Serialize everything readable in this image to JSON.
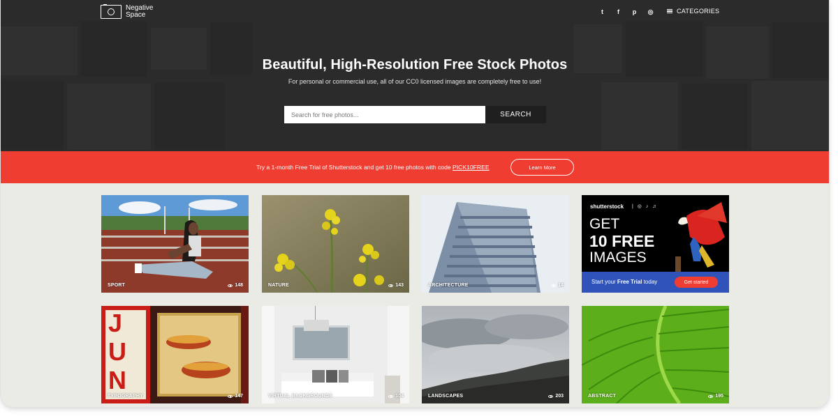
{
  "brand": {
    "line1": "Negative",
    "line2": "Space"
  },
  "nav": {
    "social": [
      "twitter",
      "facebook",
      "pinterest",
      "instagram"
    ],
    "social_glyphs": [
      "t",
      "f",
      "p",
      "◎"
    ],
    "categories_label": "CATEGORIES"
  },
  "hero": {
    "title": "Beautiful, High-Resolution Free Stock Photos",
    "subtitle": "For personal or commercial use, all of our CC0 licensed images are completely free to use!",
    "search_placeholder": "Search for free photos...",
    "search_button": "SEARCH"
  },
  "promo": {
    "text": "Try a 1-month Free Trial of Shutterstock and get 10 free photos with code ",
    "code": "PICK10FREE",
    "button": "Learn More",
    "color": "#ef3d32"
  },
  "cards": [
    {
      "category": "SPORT",
      "views": "148"
    },
    {
      "category": "NATURE",
      "views": "143"
    },
    {
      "category": "ARCHITECTURE",
      "views": "14"
    },
    {
      "category": "TYPOGRAPHY",
      "views": "147"
    },
    {
      "category": "VIRTUAL BACKGROUNDS",
      "views": "104"
    },
    {
      "category": "LANDSCAPES",
      "views": "203"
    },
    {
      "category": "ABSTRACT",
      "views": "195"
    }
  ],
  "ad": {
    "brand": "shutterstock",
    "brand_icons": "| ◎ ♪ ♫",
    "line1": "GET",
    "line2": "10 FREE",
    "line3": "IMAGES",
    "cta_prefix": "Start your ",
    "cta_bold": "Free Trial",
    "cta_suffix": " today",
    "cta_button": "Get started",
    "bar_color": "#2f53b8"
  },
  "typography_sign": "JUN"
}
